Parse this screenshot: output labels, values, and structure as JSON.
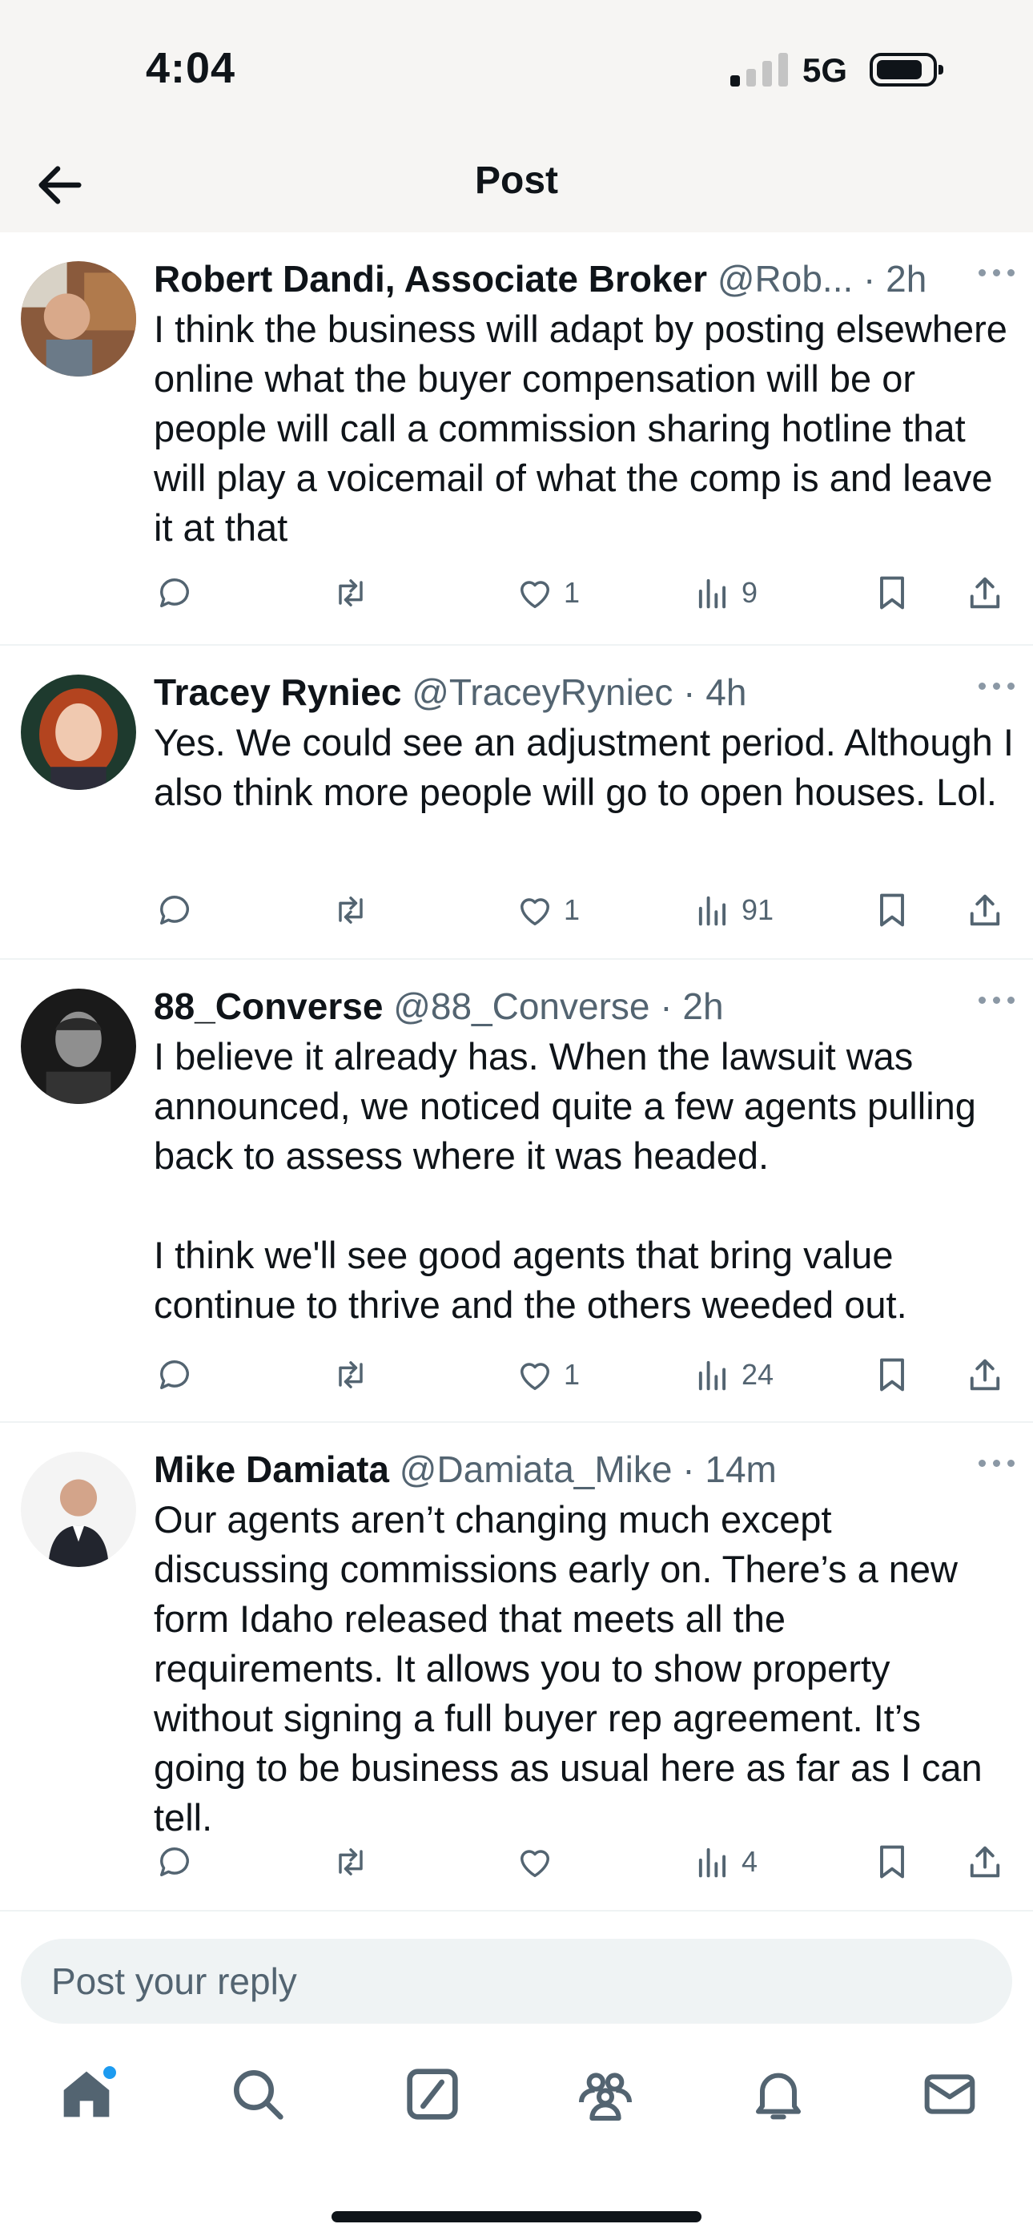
{
  "status_bar": {
    "time": "4:04",
    "network": "5G"
  },
  "header": {
    "title": "Post"
  },
  "posts": [
    {
      "name": "Robert Dandi, Associate Broker",
      "handle": "@Rob...",
      "time": "2h",
      "text": "I think the business will adapt by posting elsewhere online what the buyer compensation will be or people will call a commission sharing hotline that will play a voicemail of what the comp is and leave it at that",
      "likes": "1",
      "views": "9"
    },
    {
      "name": "Tracey Ryniec",
      "handle": "@TraceyRyniec",
      "time": "4h",
      "text": "Yes. We could see an adjustment period. Although I also think more people will go to open houses. Lol.",
      "likes": "1",
      "views": "91"
    },
    {
      "name": "88_Converse",
      "handle": "@88_Converse",
      "time": "2h",
      "text": "I believe it already has. When the lawsuit was announced, we noticed quite a few agents pulling back to assess where it was headed.\n\nI think we'll see good agents that bring value continue to thrive and the others weeded out.",
      "likes": "1",
      "views": "24"
    },
    {
      "name": "Mike Damiata",
      "handle": "@Damiata_Mike",
      "time": "14m",
      "text": "Our agents aren’t changing much except discussing commissions early on. There’s a new form Idaho released that meets all the requirements. It allows you to show property without signing a full buyer rep agreement. It’s going to be business as usual here as far as I can tell.",
      "likes": "",
      "views": "4"
    }
  ],
  "reply": {
    "placeholder": "Post your reply"
  },
  "tabs": [
    "home-icon",
    "search-icon",
    "grok-icon",
    "communities-icon",
    "notifications-icon",
    "messages-icon"
  ],
  "colors": {
    "text": "#0f1419",
    "muted": "#536471",
    "accent": "#1d9bf0",
    "divider": "#eff3f4"
  }
}
